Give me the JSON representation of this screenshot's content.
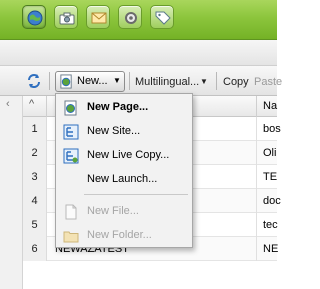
{
  "nav": {
    "items": [
      {
        "icon": "globe-icon",
        "active": true
      },
      {
        "icon": "camera-icon",
        "active": false
      },
      {
        "icon": "mail-icon",
        "active": false
      },
      {
        "icon": "tools-icon",
        "active": false
      },
      {
        "icon": "tag-icon",
        "active": false
      }
    ]
  },
  "toolbar": {
    "new_label": "New...",
    "multilingual_label": "Multilingual...",
    "copy_label": "Copy",
    "paste_label": "Paste"
  },
  "grid": {
    "sort_arrow": "^",
    "name_header": "Na",
    "rows": [
      {
        "num": "1",
        "title": "",
        "name": "bos"
      },
      {
        "num": "2",
        "title": "",
        "name": "Oli"
      },
      {
        "num": "3",
        "title": "",
        "name": "TE"
      },
      {
        "num": "4",
        "title": "",
        "name": "doc"
      },
      {
        "num": "5",
        "title": "",
        "name": "tec"
      },
      {
        "num": "6",
        "title": "NEWAZATEST",
        "name": "NE"
      }
    ]
  },
  "menu": {
    "items": [
      {
        "label": "New Page...",
        "icon": "page-icon",
        "enabled": true,
        "bold": true
      },
      {
        "label": "New Site...",
        "icon": "site-icon",
        "enabled": true,
        "bold": false
      },
      {
        "label": "New Live Copy...",
        "icon": "live-copy-icon",
        "enabled": true,
        "bold": false
      },
      {
        "label": "New Launch...",
        "icon": "",
        "enabled": true,
        "bold": false
      },
      {
        "label": "New File...",
        "icon": "file-icon",
        "enabled": false,
        "bold": false
      },
      {
        "label": "New Folder...",
        "icon": "folder-icon",
        "enabled": false,
        "bold": false
      }
    ]
  },
  "colors": {
    "nav_green": "#8cc53c",
    "menu_bg": "#f2f2f2",
    "disabled_text": "#a5a5a5"
  }
}
